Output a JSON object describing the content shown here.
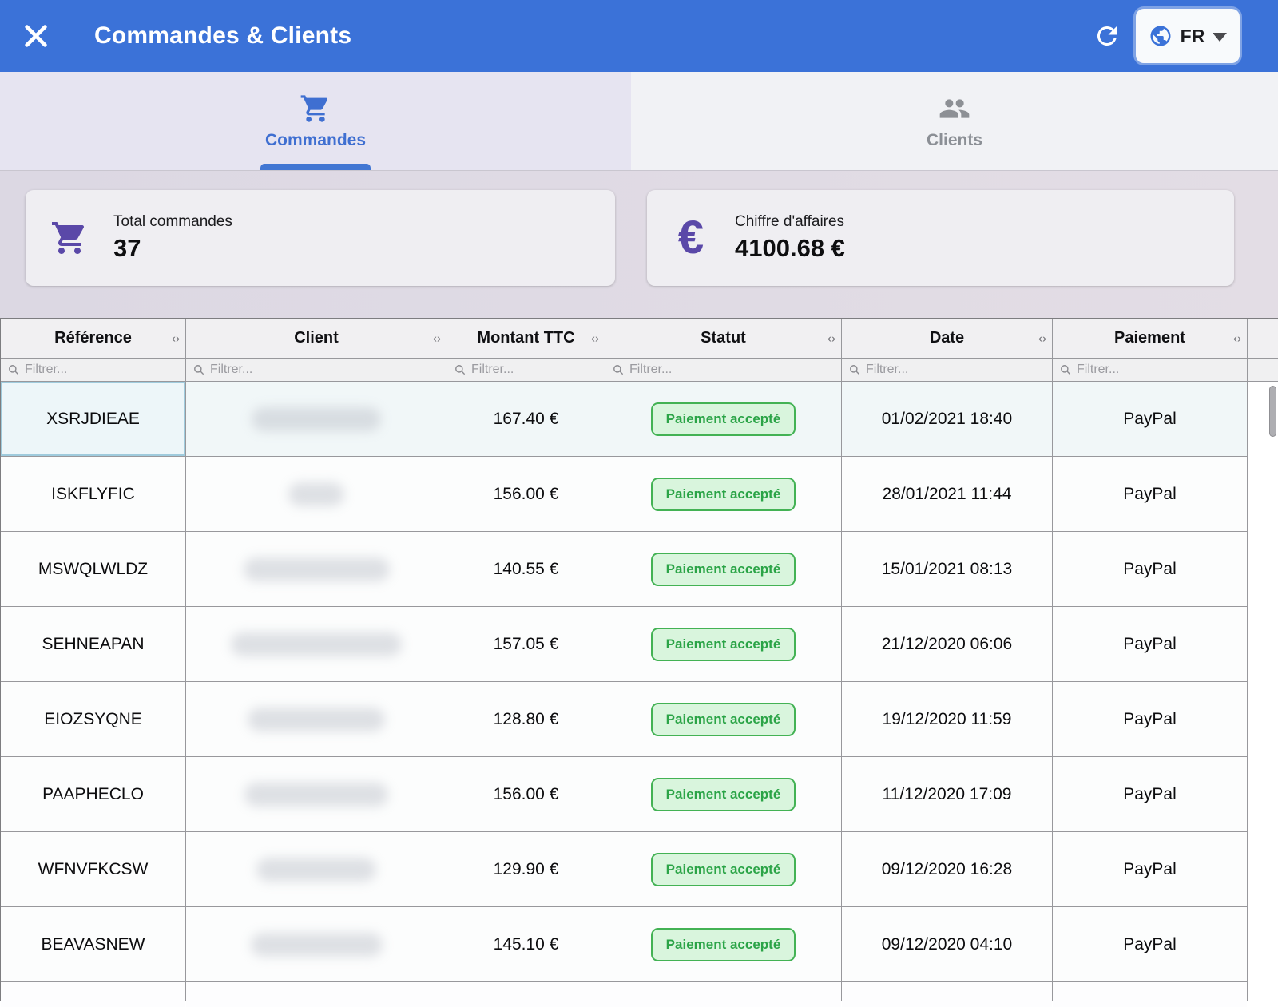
{
  "appbar": {
    "title": "Commandes & Clients",
    "language": "FR"
  },
  "tabs": {
    "commandes": {
      "label": "Commandes",
      "active": true
    },
    "clients": {
      "label": "Clients",
      "active": false
    }
  },
  "cards": {
    "orders": {
      "label": "Total commandes",
      "value": "37"
    },
    "revenue": {
      "label": "Chiffre d'affaires",
      "value": "4100.68 €"
    }
  },
  "table": {
    "columns": [
      "Référence",
      "Client",
      "Montant TTC",
      "Statut",
      "Date",
      "Paiement"
    ],
    "sort_icon": "‹›",
    "filter_placeholder": "Filtrer...",
    "client_column_redacted": true,
    "rows": [
      {
        "reference": "XSRJDIEAE",
        "amount": "167.40 €",
        "status": "Paiement accepté",
        "date": "01/02/2021 18:40",
        "payment": "PayPal"
      },
      {
        "reference": "ISKFLYFIC",
        "amount": "156.00 €",
        "status": "Paiement accepté",
        "date": "28/01/2021 11:44",
        "payment": "PayPal"
      },
      {
        "reference": "MSWQLWLDZ",
        "amount": "140.55 €",
        "status": "Paiement accepté",
        "date": "15/01/2021 08:13",
        "payment": "PayPal"
      },
      {
        "reference": "SEHNEAPAN",
        "amount": "157.05 €",
        "status": "Paiement accepté",
        "date": "21/12/2020 06:06",
        "payment": "PayPal"
      },
      {
        "reference": "EIOZSYQNE",
        "amount": "128.80 €",
        "status": "Paiement accepté",
        "date": "19/12/2020 11:59",
        "payment": "PayPal"
      },
      {
        "reference": "PAAPHECLO",
        "amount": "156.00 €",
        "status": "Paiement accepté",
        "date": "11/12/2020 17:09",
        "payment": "PayPal"
      },
      {
        "reference": "WFNVFKCSW",
        "amount": "129.90 €",
        "status": "Paiement accepté",
        "date": "09/12/2020 16:28",
        "payment": "PayPal"
      },
      {
        "reference": "BEAVASNEW",
        "amount": "145.10 €",
        "status": "Paiement accepté",
        "date": "09/12/2020 04:10",
        "payment": "PayPal"
      }
    ]
  },
  "icons": {
    "close": "close-icon",
    "refresh": "refresh-icon",
    "globe": "globe-icon",
    "cart": "shopping-cart-icon",
    "people": "people-icon",
    "euro": "euro-icon",
    "search": "search-icon",
    "caret": "chevron-down-icon"
  },
  "colors": {
    "appbar_blue": "#3b72d8",
    "accent_purple": "#5a48a8",
    "tab_active_blue": "#3f6fd1",
    "badge_green_text": "#2ba447",
    "badge_green_bg": "#d9f5dd",
    "badge_green_border": "#43b254",
    "selected_cell_border": "#9fcbdd"
  }
}
